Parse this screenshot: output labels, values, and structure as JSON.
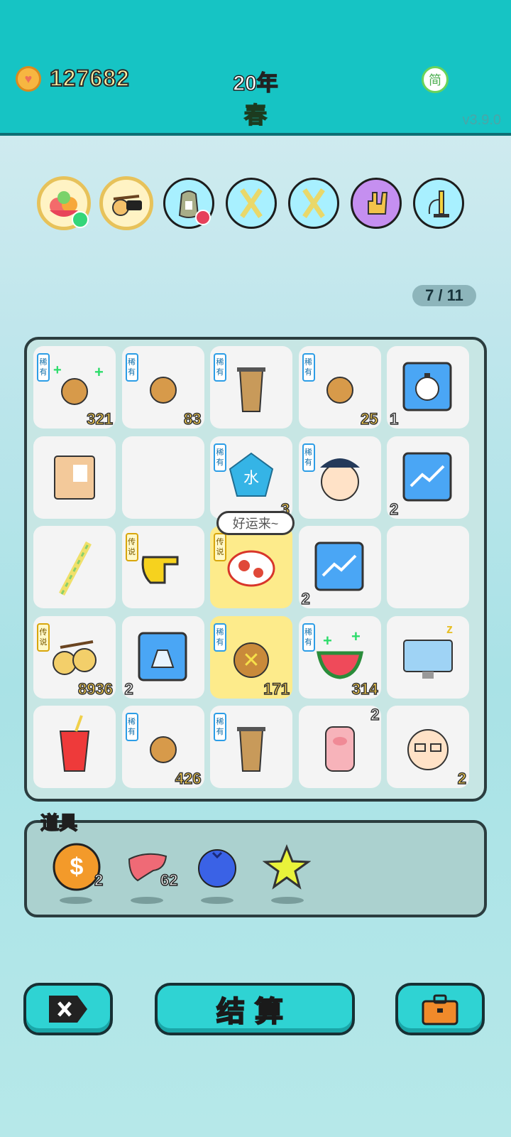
{
  "header": {
    "coins": "127682",
    "year": "20年",
    "season": "春",
    "lang_label": "简",
    "version": "v3.9.0"
  },
  "controls": [
    {
      "name": "fruit-basket-icon",
      "active": true
    },
    {
      "name": "cat-toy-icon",
      "active": true
    },
    {
      "name": "seed-bag-icon",
      "active": false
    },
    {
      "name": "straw-cross-icon",
      "active": false
    },
    {
      "name": "straw-cross-icon",
      "active": false
    },
    {
      "name": "rock-hand-icon",
      "active": false
    },
    {
      "name": "air-pump-icon",
      "active": false
    }
  ],
  "page_indicator": "7 / 11",
  "board": {
    "bubble_text": "好运来~",
    "rarity_labels": {
      "rare": "稀有",
      "legend": "传说"
    },
    "cells": [
      {
        "icon": "orange-plus-icon",
        "rarity": "rare",
        "count": "321",
        "pos": "br"
      },
      {
        "icon": "orange-icon",
        "rarity": "rare",
        "count": "83",
        "pos": "br"
      },
      {
        "icon": "bubble-tea-icon",
        "rarity": "rare",
        "count": "",
        "pos": "br"
      },
      {
        "icon": "orange-icon",
        "rarity": "rare",
        "count": "25",
        "pos": "br"
      },
      {
        "icon": "stopwatch-card-icon",
        "rarity": "",
        "count": "1",
        "pos": "bl"
      },
      {
        "icon": "package-box-icon",
        "rarity": "",
        "count": "",
        "pos": "br"
      },
      {
        "icon": "",
        "rarity": "",
        "count": "",
        "pos": "br"
      },
      {
        "icon": "water-gem-icon",
        "rarity": "rare",
        "count": "3",
        "pos": "br"
      },
      {
        "icon": "police-face-icon",
        "rarity": "rare",
        "count": "",
        "pos": "br"
      },
      {
        "icon": "chart-card-icon",
        "rarity": "",
        "count": "2",
        "pos": "bl"
      },
      {
        "icon": "straw-icon",
        "rarity": "",
        "count": "",
        "pos": "br"
      },
      {
        "icon": "pointing-hand-icon",
        "rarity": "legend",
        "count": "",
        "pos": "br"
      },
      {
        "icon": "koi-fish-icon",
        "rarity": "legend",
        "count": "",
        "pos": "br",
        "highlight": true
      },
      {
        "icon": "chart-card-icon",
        "rarity": "",
        "count": "2",
        "pos": "bl"
      },
      {
        "icon": "",
        "rarity": "",
        "count": "",
        "pos": "br"
      },
      {
        "icon": "twin-oranges-icon",
        "rarity": "legend",
        "count": "8936",
        "pos": "br"
      },
      {
        "icon": "gold-bars-card-icon",
        "rarity": "",
        "count": "2",
        "pos": "bl"
      },
      {
        "icon": "orange-x-icon",
        "rarity": "rare",
        "count": "171",
        "pos": "br",
        "highlight": true
      },
      {
        "icon": "watermelon-plus-icon",
        "rarity": "rare",
        "count": "314",
        "pos": "br"
      },
      {
        "icon": "sleepy-computer-icon",
        "rarity": "",
        "count": "",
        "pos": "br"
      },
      {
        "icon": "soda-cup-icon",
        "rarity": "",
        "count": "",
        "pos": "br"
      },
      {
        "icon": "orange-icon",
        "rarity": "rare",
        "count": "426",
        "pos": "br"
      },
      {
        "icon": "bubble-tea-icon",
        "rarity": "rare",
        "count": "",
        "pos": "br"
      },
      {
        "icon": "pig-icon",
        "rarity": "",
        "count": "2",
        "pos": "tr"
      },
      {
        "icon": "grandpa-face-icon",
        "rarity": "",
        "count": "2",
        "pos": "br"
      }
    ]
  },
  "props": {
    "title": "道具",
    "items": [
      {
        "icon": "dollar-coin-icon",
        "count": "2"
      },
      {
        "icon": "liver-icon",
        "count": "62"
      },
      {
        "icon": "blueberry-icon",
        "count": ""
      },
      {
        "icon": "star-icon",
        "count": ""
      }
    ]
  },
  "buttons": {
    "remove_icon": "remove-tag-icon",
    "settle_label": "结算",
    "bag_icon": "briefcase-icon"
  },
  "colors": {
    "topbar": "#16c4c4",
    "button": "#2fd3d3",
    "rare_tag": "#2c9de6",
    "legend_tag": "#d8a60c",
    "highlight": "#fdeb8b"
  }
}
